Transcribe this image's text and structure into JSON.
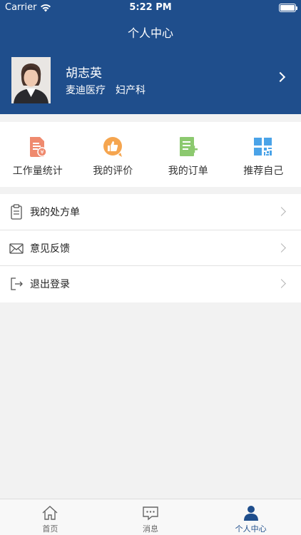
{
  "status_bar": {
    "carrier": "Carrier",
    "time": "5:22 PM"
  },
  "header": {
    "title": "个人中心"
  },
  "profile": {
    "name": "胡志英",
    "hospital": "麦迪医疗",
    "department": "妇产科"
  },
  "shortcuts": [
    {
      "label": "工作量统计",
      "icon": "workload-document-icon",
      "color": "#ef8a6e"
    },
    {
      "label": "我的评价",
      "icon": "thumbs-up-icon",
      "color": "#f5a54f"
    },
    {
      "label": "我的订单",
      "icon": "order-list-icon",
      "color": "#8cc96f"
    },
    {
      "label": "推荐自己",
      "icon": "qr-code-icon",
      "color": "#4aa3e8"
    }
  ],
  "menu": [
    {
      "label": "我的处方单",
      "icon": "clipboard-icon"
    },
    {
      "label": "意见反馈",
      "icon": "envelope-icon"
    },
    {
      "label": "退出登录",
      "icon": "logout-icon"
    }
  ],
  "tabbar": [
    {
      "label": "首页",
      "icon": "home-icon"
    },
    {
      "label": "消息",
      "icon": "message-icon"
    },
    {
      "label": "个人中心",
      "icon": "person-icon",
      "active": true
    }
  ],
  "colors": {
    "brand": "#1f4e8c",
    "background": "#f2f2f2"
  }
}
